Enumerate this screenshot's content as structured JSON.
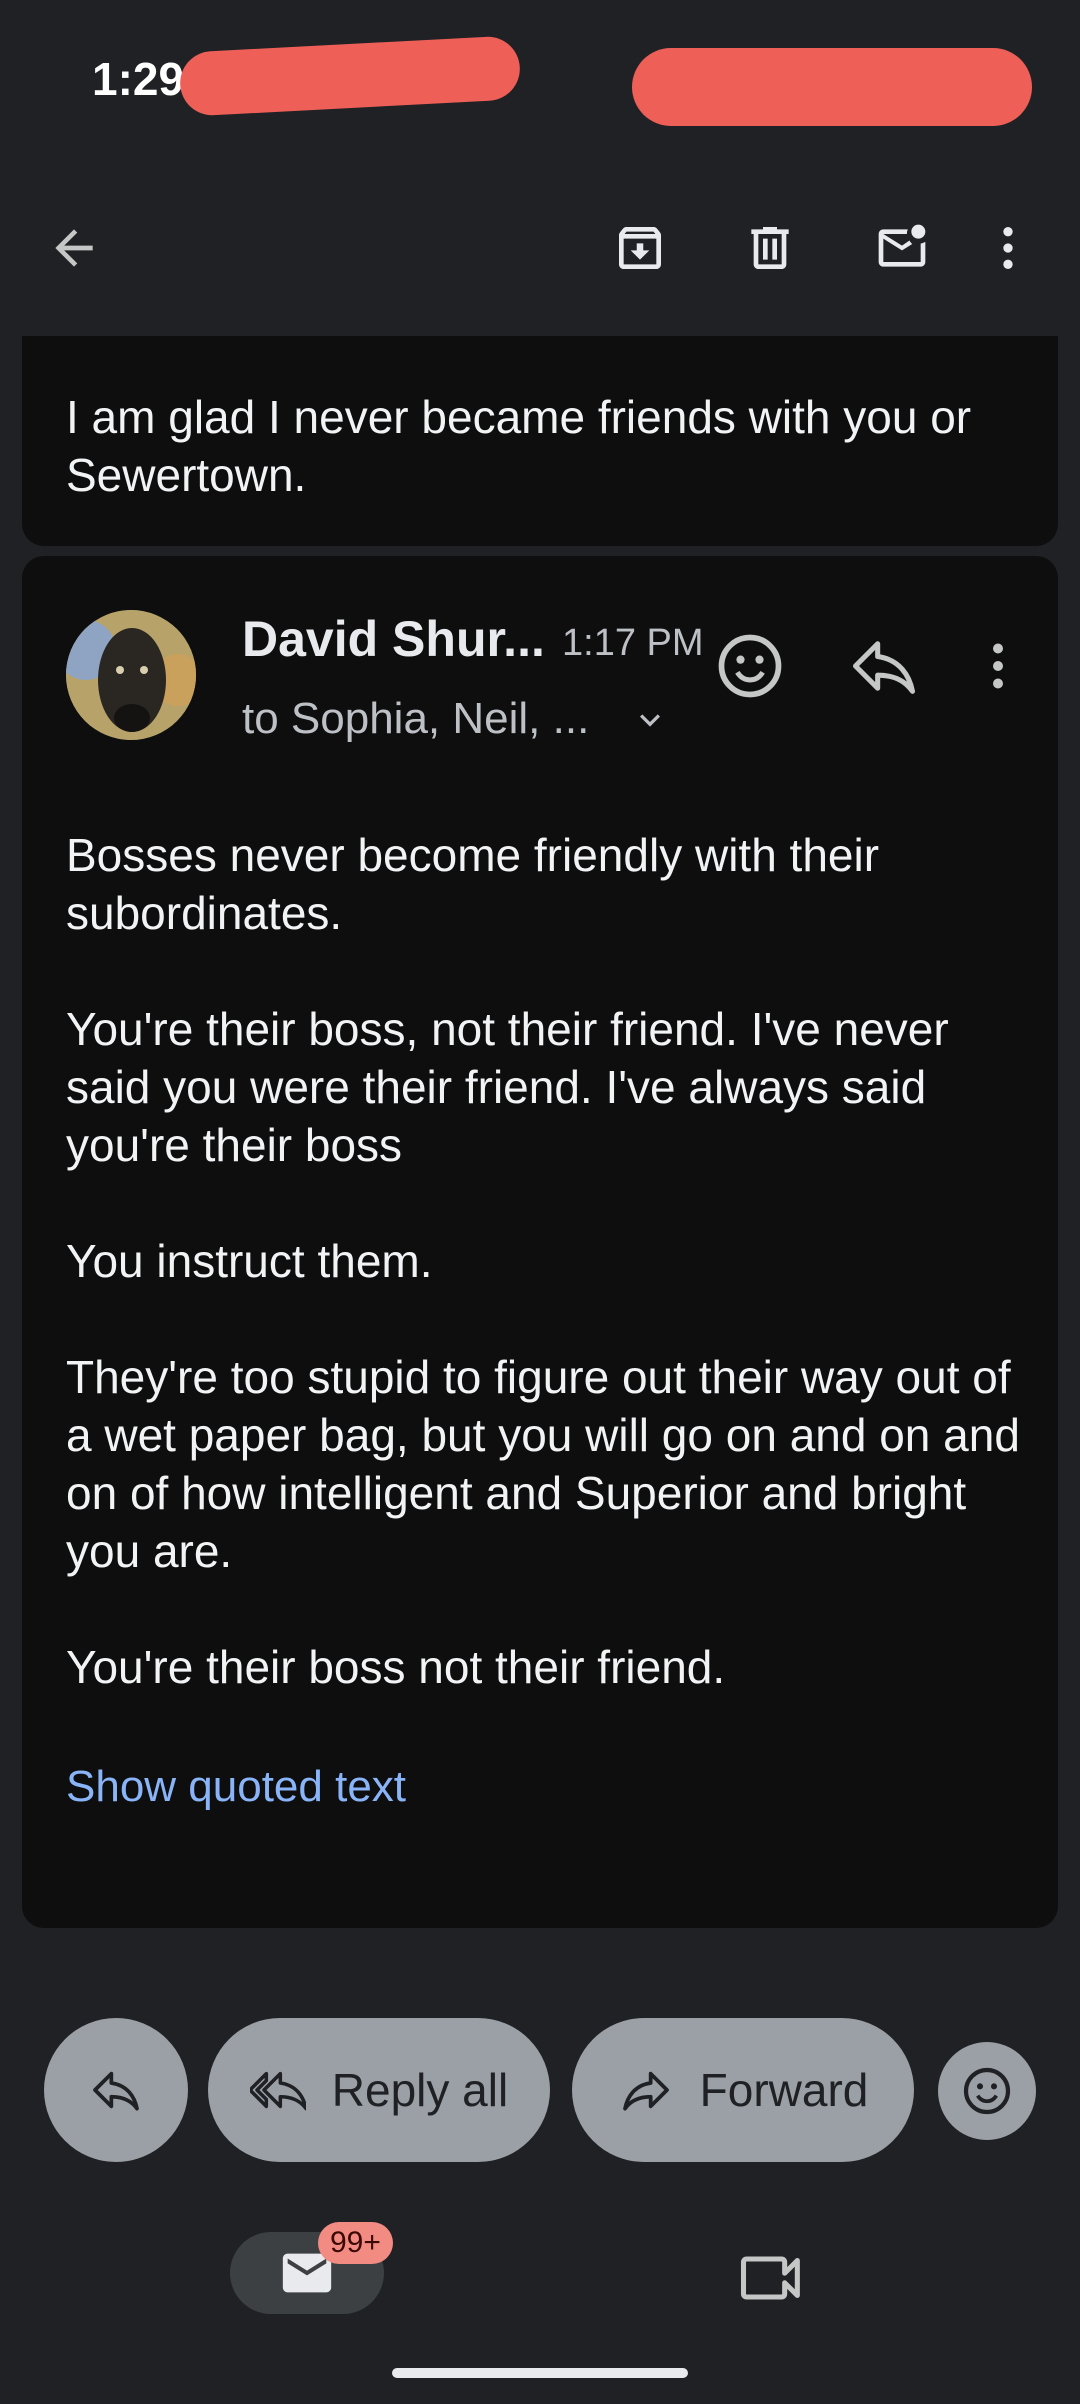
{
  "status_bar": {
    "time": "1:29"
  },
  "toolbar": {
    "icons": [
      "back-arrow-icon",
      "archive-icon",
      "delete-icon",
      "mark-unread-icon",
      "more-vert-icon"
    ]
  },
  "previous_message": {
    "text": "I am glad I never became friends with you or Sewertown."
  },
  "message": {
    "sender": "David Shur...",
    "time": "1:17 PM",
    "recipients": "to Sophia, Neil, ...",
    "paragraphs": [
      "Bosses never become friendly with their subordinates.",
      "You're their boss, not their friend. I've never said you were their friend. I've always said you're their boss",
      "You instruct them.",
      "They're too stupid to figure out their way out of a wet paper bag, but you will go on and on and on of how intelligent and Superior and bright you are.",
      "You're their boss not their friend."
    ],
    "show_quoted": "Show quoted text"
  },
  "actions": {
    "reply_all": "Reply all",
    "forward": "Forward"
  },
  "bottom_nav": {
    "mail_badge": "99+"
  },
  "colors": {
    "background": "#202124",
    "card": "#0e0e0f",
    "link": "#8ab4f8",
    "pill": "#9aa0a6",
    "badge": "#f28b82",
    "redaction": "#ee5f58"
  }
}
